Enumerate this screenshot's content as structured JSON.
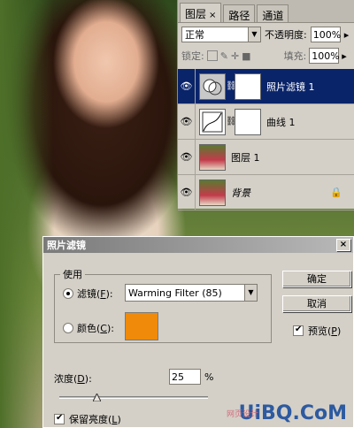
{
  "colors": {
    "title_bar": "#0a246a",
    "filter_color": "#f08a0a",
    "panel_bg": "#d4d0c8",
    "watermark_blue": "#2d5aa0"
  },
  "layers_panel": {
    "tabs": [
      {
        "label": "图层",
        "close": "×"
      },
      {
        "label": "路径"
      },
      {
        "label": "通道"
      }
    ],
    "blend_mode": "正常",
    "opacity_label": "不透明度:",
    "opacity_value": "100%",
    "lock_label": "锁定:",
    "fill_label": "填充:",
    "fill_value": "100%",
    "layers": [
      {
        "name": "照片滤镜 1",
        "selected": true,
        "thumb_icon": "photo-filter-adjustment-icon",
        "has_mask": true
      },
      {
        "name": "曲线 1",
        "selected": false,
        "thumb_icon": "curves-adjustment-icon",
        "has_mask": true
      },
      {
        "name": "图层 1",
        "selected": false,
        "thumb_icon": "photo-thumbnail",
        "has_mask": false
      },
      {
        "name": "背景",
        "selected": false,
        "thumb_icon": "photo-thumbnail",
        "has_mask": false,
        "locked": true
      }
    ]
  },
  "dialog": {
    "title": "照片滤镜",
    "close": "×",
    "group_label": "使用",
    "filter_option": {
      "label": "滤镜(",
      "key": "F",
      "suffix": "):",
      "selected": true,
      "value": "Warming Filter (85)"
    },
    "color_option": {
      "label": "颜色(",
      "key": "C",
      "suffix": "):",
      "selected": false
    },
    "ok_button": "确定",
    "cancel_button": "取消",
    "preview_label": "预览(",
    "preview_key": "P",
    "preview_suffix": ")",
    "preview_checked": true,
    "density_label": "浓度(",
    "density_key": "D",
    "density_suffix": "):",
    "density_value": "25",
    "density_unit": "%",
    "density_level": 25,
    "preserve_label": "保留亮度(",
    "preserve_key": "L",
    "preserve_suffix": ")",
    "preserve_checked": true
  },
  "watermark": {
    "text": "UiBQ.CoM",
    "small": "网页设计"
  }
}
